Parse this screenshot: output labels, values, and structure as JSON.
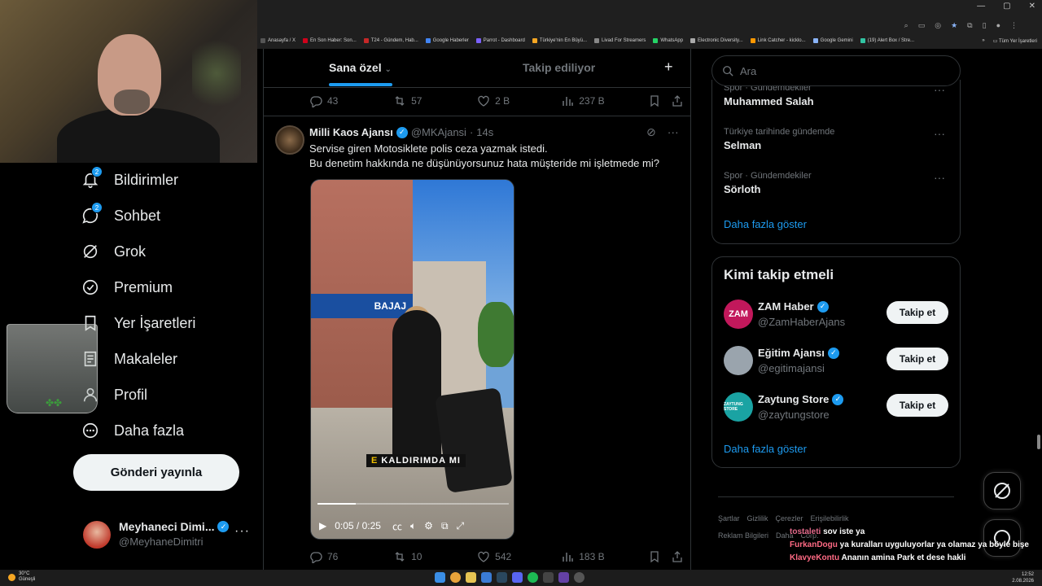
{
  "browser": {
    "bookmarks": [
      {
        "label": "Anasayfa / X",
        "color": "#555555"
      },
      {
        "label": "En Son Haber: Son...",
        "color": "#d0021b"
      },
      {
        "label": "T24 - Gündem, Hab...",
        "color": "#c62828"
      },
      {
        "label": "Google Haberler",
        "color": "#4285f4"
      },
      {
        "label": "Parrot - Dashboard",
        "color": "#7b61ff"
      },
      {
        "label": "Türkiye'nin En Büyü...",
        "color": "#f5a623"
      },
      {
        "label": "Livad For Streamers",
        "color": "#888888"
      },
      {
        "label": "WhatsApp",
        "color": "#25d366"
      },
      {
        "label": "Electronic Diversity...",
        "color": "#aaaaaa"
      },
      {
        "label": "Link Catcher - kicklo...",
        "color": "#ff9800"
      },
      {
        "label": "Google Gemini",
        "color": "#8ab4f8"
      },
      {
        "label": "(19) Alert Box / Stre...",
        "color": "#31c3a2"
      }
    ],
    "more_bookmarks": "»",
    "all_bookmarks": "Tüm Yer İşaretleri"
  },
  "nav": {
    "items": [
      {
        "label": "Bildirimler",
        "icon": "bell-icon",
        "badge": "2"
      },
      {
        "label": "Sohbet",
        "icon": "chat-icon",
        "badge": "2"
      },
      {
        "label": "Grok",
        "icon": "grok-icon",
        "badge": ""
      },
      {
        "label": "Premium",
        "icon": "premium-icon",
        "badge": ""
      },
      {
        "label": "Yer İşaretleri",
        "icon": "bookmark-icon",
        "badge": ""
      },
      {
        "label": "Makaleler",
        "icon": "articles-icon",
        "badge": ""
      },
      {
        "label": "Profil",
        "icon": "profile-icon",
        "badge": ""
      },
      {
        "label": "Daha fazla",
        "icon": "more-icon",
        "badge": ""
      }
    ],
    "post_button": "Gönderi yayınla",
    "account": {
      "name": "Meyhaneci Dimi...",
      "handle": "@MeyhaneDimitri",
      "more": "···"
    }
  },
  "timeline": {
    "tab_active": "Sana özel",
    "tab_other": "Takip ediliyor",
    "tab_add": "+",
    "prev_tweet_actions": {
      "replies": "43",
      "reposts": "57",
      "likes": "2 B",
      "views": "237 B"
    },
    "tweet": {
      "name": "Milli Kaos Ajansı",
      "handle": "@MKAjansi",
      "dot": "·",
      "time": "14s",
      "line1": "Servise giren Motosiklete polis ceza yazmak istedi.",
      "line2": "Bu denetim hakkında ne düşünüyorsunuz hata müşteride mi işletmede mi?",
      "video": {
        "store_sign": "BAJAJ",
        "caption_highlight": "E",
        "caption_text": " KALDIRIMDA MI",
        "time": "0:05 / 0:25",
        "progress": 0.2
      },
      "actions": {
        "replies": "76",
        "reposts": "10",
        "likes": "542",
        "views": "183 B"
      }
    }
  },
  "sidebar": {
    "search_placeholder": "Ara",
    "trends": [
      {
        "category": "Spor · Gündemdekiler",
        "title": "Muhammed Salah"
      },
      {
        "category": "Türkiye tarihinde gündemde",
        "title": "Selman"
      },
      {
        "category": "Spor · Gündemdekiler",
        "title": "Sörloth"
      }
    ],
    "trends_more": "Daha fazla göster",
    "follow_title": "Kimi takip etmeli",
    "follow": [
      {
        "name": "ZAM Haber",
        "handle": "@ZamHaberAjans",
        "avatar_text": "ZAM",
        "avatar_color": "#c2185b"
      },
      {
        "name": "Eğitim Ajansı",
        "handle": "@egitimajansi",
        "avatar_text": "",
        "avatar_color": "#9aa4ad"
      },
      {
        "name": "Zaytung Store",
        "handle": "@zaytungstore",
        "avatar_text": "ZAYTUNG STORE",
        "avatar_color": "#1aa3a3"
      }
    ],
    "follow_button": "Takip et",
    "follow_more": "Daha fazla göster",
    "footer": [
      "Şartlar",
      "Gizlilik",
      "Çerezler",
      "Erişilebilirlik",
      "Reklam Bilgileri",
      "Daha",
      "Corp."
    ]
  },
  "chat": [
    {
      "user": "tostaleti",
      "text": "sov iste ya"
    },
    {
      "user": "FurkanDogu",
      "text": "ya kuralları uyguluyorlar ya olamaz ya böyle bişe"
    },
    {
      "user": "KlavyeKontu",
      "text": "Ananın amina Park et dese hakli"
    }
  ],
  "taskbar": {
    "temp": "30°C",
    "weather": "Güneşli",
    "time": "12:52",
    "date": "2.08.2026"
  },
  "colors": {
    "accent": "#1d9bf0",
    "background": "#000000",
    "muted": "#71767b"
  }
}
